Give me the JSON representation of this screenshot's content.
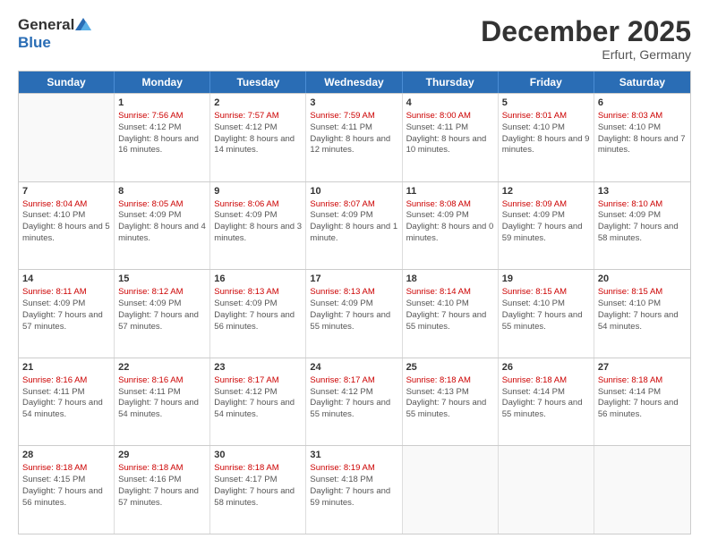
{
  "header": {
    "logo_general": "General",
    "logo_blue": "Blue",
    "title": "December 2025",
    "location": "Erfurt, Germany"
  },
  "columns": [
    "Sunday",
    "Monday",
    "Tuesday",
    "Wednesday",
    "Thursday",
    "Friday",
    "Saturday"
  ],
  "rows": [
    [
      {
        "day": "",
        "sunrise": "",
        "sunset": "",
        "daylight": ""
      },
      {
        "day": "1",
        "sunrise": "Sunrise: 7:56 AM",
        "sunset": "Sunset: 4:12 PM",
        "daylight": "Daylight: 8 hours and 16 minutes."
      },
      {
        "day": "2",
        "sunrise": "Sunrise: 7:57 AM",
        "sunset": "Sunset: 4:12 PM",
        "daylight": "Daylight: 8 hours and 14 minutes."
      },
      {
        "day": "3",
        "sunrise": "Sunrise: 7:59 AM",
        "sunset": "Sunset: 4:11 PM",
        "daylight": "Daylight: 8 hours and 12 minutes."
      },
      {
        "day": "4",
        "sunrise": "Sunrise: 8:00 AM",
        "sunset": "Sunset: 4:11 PM",
        "daylight": "Daylight: 8 hours and 10 minutes."
      },
      {
        "day": "5",
        "sunrise": "Sunrise: 8:01 AM",
        "sunset": "Sunset: 4:10 PM",
        "daylight": "Daylight: 8 hours and 9 minutes."
      },
      {
        "day": "6",
        "sunrise": "Sunrise: 8:03 AM",
        "sunset": "Sunset: 4:10 PM",
        "daylight": "Daylight: 8 hours and 7 minutes."
      }
    ],
    [
      {
        "day": "7",
        "sunrise": "Sunrise: 8:04 AM",
        "sunset": "Sunset: 4:10 PM",
        "daylight": "Daylight: 8 hours and 5 minutes."
      },
      {
        "day": "8",
        "sunrise": "Sunrise: 8:05 AM",
        "sunset": "Sunset: 4:09 PM",
        "daylight": "Daylight: 8 hours and 4 minutes."
      },
      {
        "day": "9",
        "sunrise": "Sunrise: 8:06 AM",
        "sunset": "Sunset: 4:09 PM",
        "daylight": "Daylight: 8 hours and 3 minutes."
      },
      {
        "day": "10",
        "sunrise": "Sunrise: 8:07 AM",
        "sunset": "Sunset: 4:09 PM",
        "daylight": "Daylight: 8 hours and 1 minute."
      },
      {
        "day": "11",
        "sunrise": "Sunrise: 8:08 AM",
        "sunset": "Sunset: 4:09 PM",
        "daylight": "Daylight: 8 hours and 0 minutes."
      },
      {
        "day": "12",
        "sunrise": "Sunrise: 8:09 AM",
        "sunset": "Sunset: 4:09 PM",
        "daylight": "Daylight: 7 hours and 59 minutes."
      },
      {
        "day": "13",
        "sunrise": "Sunrise: 8:10 AM",
        "sunset": "Sunset: 4:09 PM",
        "daylight": "Daylight: 7 hours and 58 minutes."
      }
    ],
    [
      {
        "day": "14",
        "sunrise": "Sunrise: 8:11 AM",
        "sunset": "Sunset: 4:09 PM",
        "daylight": "Daylight: 7 hours and 57 minutes."
      },
      {
        "day": "15",
        "sunrise": "Sunrise: 8:12 AM",
        "sunset": "Sunset: 4:09 PM",
        "daylight": "Daylight: 7 hours and 57 minutes."
      },
      {
        "day": "16",
        "sunrise": "Sunrise: 8:13 AM",
        "sunset": "Sunset: 4:09 PM",
        "daylight": "Daylight: 7 hours and 56 minutes."
      },
      {
        "day": "17",
        "sunrise": "Sunrise: 8:13 AM",
        "sunset": "Sunset: 4:09 PM",
        "daylight": "Daylight: 7 hours and 55 minutes."
      },
      {
        "day": "18",
        "sunrise": "Sunrise: 8:14 AM",
        "sunset": "Sunset: 4:10 PM",
        "daylight": "Daylight: 7 hours and 55 minutes."
      },
      {
        "day": "19",
        "sunrise": "Sunrise: 8:15 AM",
        "sunset": "Sunset: 4:10 PM",
        "daylight": "Daylight: 7 hours and 55 minutes."
      },
      {
        "day": "20",
        "sunrise": "Sunrise: 8:15 AM",
        "sunset": "Sunset: 4:10 PM",
        "daylight": "Daylight: 7 hours and 54 minutes."
      }
    ],
    [
      {
        "day": "21",
        "sunrise": "Sunrise: 8:16 AM",
        "sunset": "Sunset: 4:11 PM",
        "daylight": "Daylight: 7 hours and 54 minutes."
      },
      {
        "day": "22",
        "sunrise": "Sunrise: 8:16 AM",
        "sunset": "Sunset: 4:11 PM",
        "daylight": "Daylight: 7 hours and 54 minutes."
      },
      {
        "day": "23",
        "sunrise": "Sunrise: 8:17 AM",
        "sunset": "Sunset: 4:12 PM",
        "daylight": "Daylight: 7 hours and 54 minutes."
      },
      {
        "day": "24",
        "sunrise": "Sunrise: 8:17 AM",
        "sunset": "Sunset: 4:12 PM",
        "daylight": "Daylight: 7 hours and 55 minutes."
      },
      {
        "day": "25",
        "sunrise": "Sunrise: 8:18 AM",
        "sunset": "Sunset: 4:13 PM",
        "daylight": "Daylight: 7 hours and 55 minutes."
      },
      {
        "day": "26",
        "sunrise": "Sunrise: 8:18 AM",
        "sunset": "Sunset: 4:14 PM",
        "daylight": "Daylight: 7 hours and 55 minutes."
      },
      {
        "day": "27",
        "sunrise": "Sunrise: 8:18 AM",
        "sunset": "Sunset: 4:14 PM",
        "daylight": "Daylight: 7 hours and 56 minutes."
      }
    ],
    [
      {
        "day": "28",
        "sunrise": "Sunrise: 8:18 AM",
        "sunset": "Sunset: 4:15 PM",
        "daylight": "Daylight: 7 hours and 56 minutes."
      },
      {
        "day": "29",
        "sunrise": "Sunrise: 8:18 AM",
        "sunset": "Sunset: 4:16 PM",
        "daylight": "Daylight: 7 hours and 57 minutes."
      },
      {
        "day": "30",
        "sunrise": "Sunrise: 8:18 AM",
        "sunset": "Sunset: 4:17 PM",
        "daylight": "Daylight: 7 hours and 58 minutes."
      },
      {
        "day": "31",
        "sunrise": "Sunrise: 8:19 AM",
        "sunset": "Sunset: 4:18 PM",
        "daylight": "Daylight: 7 hours and 59 minutes."
      },
      {
        "day": "",
        "sunrise": "",
        "sunset": "",
        "daylight": ""
      },
      {
        "day": "",
        "sunrise": "",
        "sunset": "",
        "daylight": ""
      },
      {
        "day": "",
        "sunrise": "",
        "sunset": "",
        "daylight": ""
      }
    ]
  ]
}
